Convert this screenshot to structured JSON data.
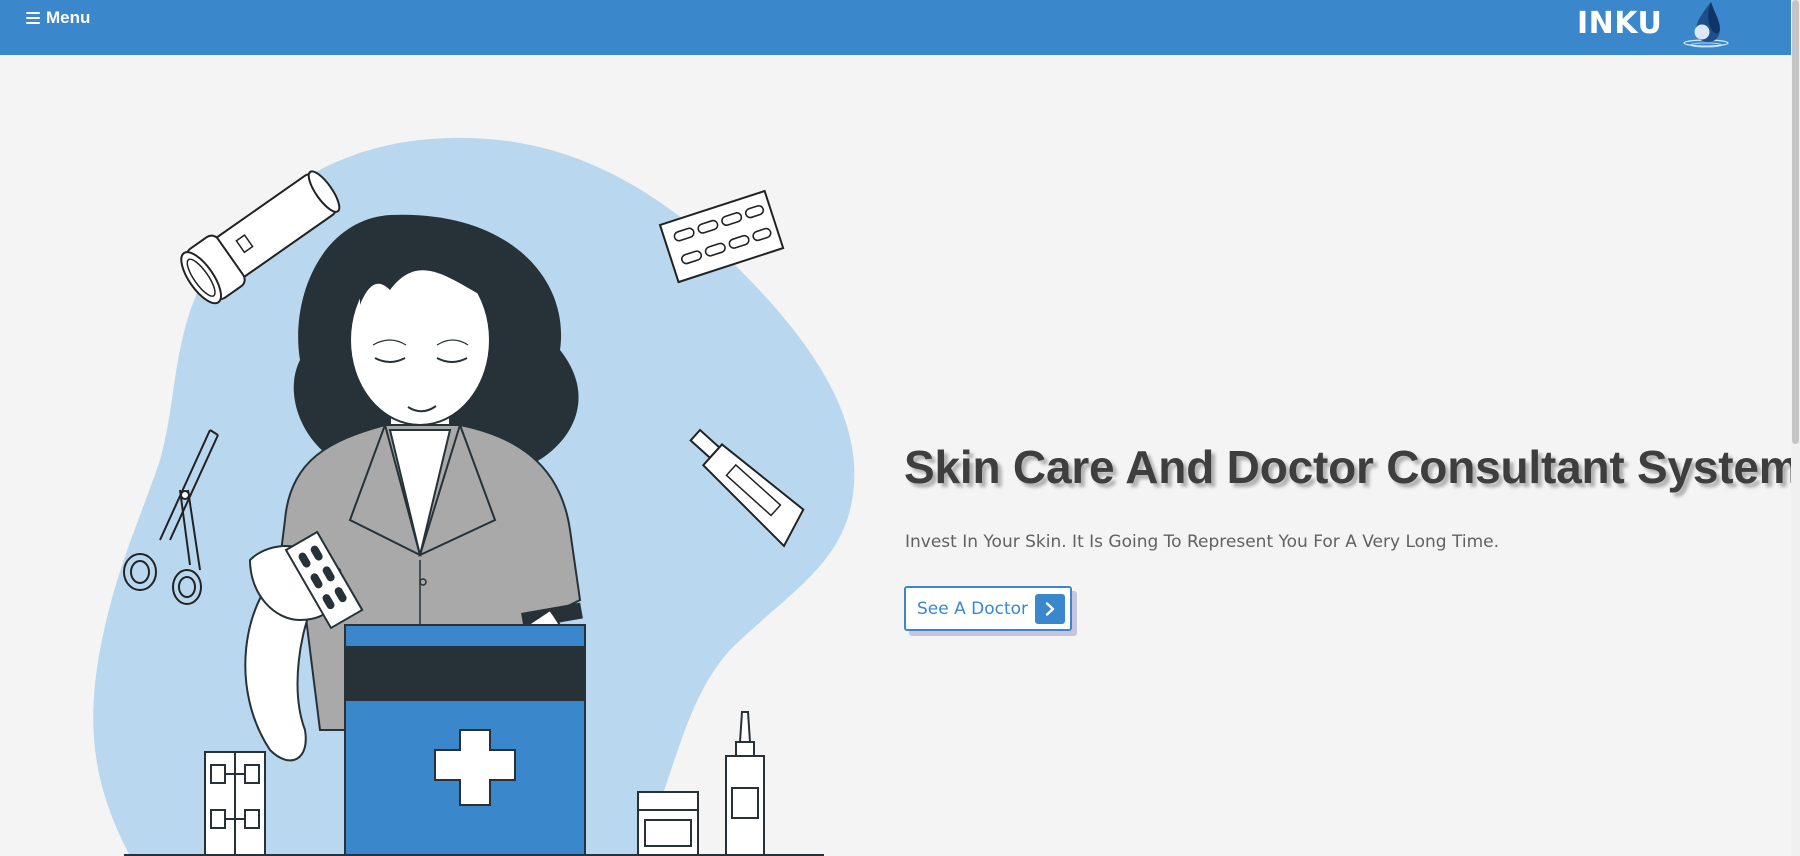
{
  "navbar": {
    "menu_label": "Menu",
    "brand": "INKU",
    "logo_icon": "water-drop-logo-icon",
    "background_color": "#3b87cc"
  },
  "hero": {
    "title": "Skin Care And Doctor Consultant System",
    "subtitle": "Invest In Your Skin. It Is Going To Represent You For A Very Long Time.",
    "cta_label": "See A Doctor",
    "cta_icon": "chevron-right-icon",
    "illustration": "doctor-with-first-aid-kit-illustration",
    "accent_color": "#3b87cc",
    "blob_color": "#b9d8ef"
  }
}
